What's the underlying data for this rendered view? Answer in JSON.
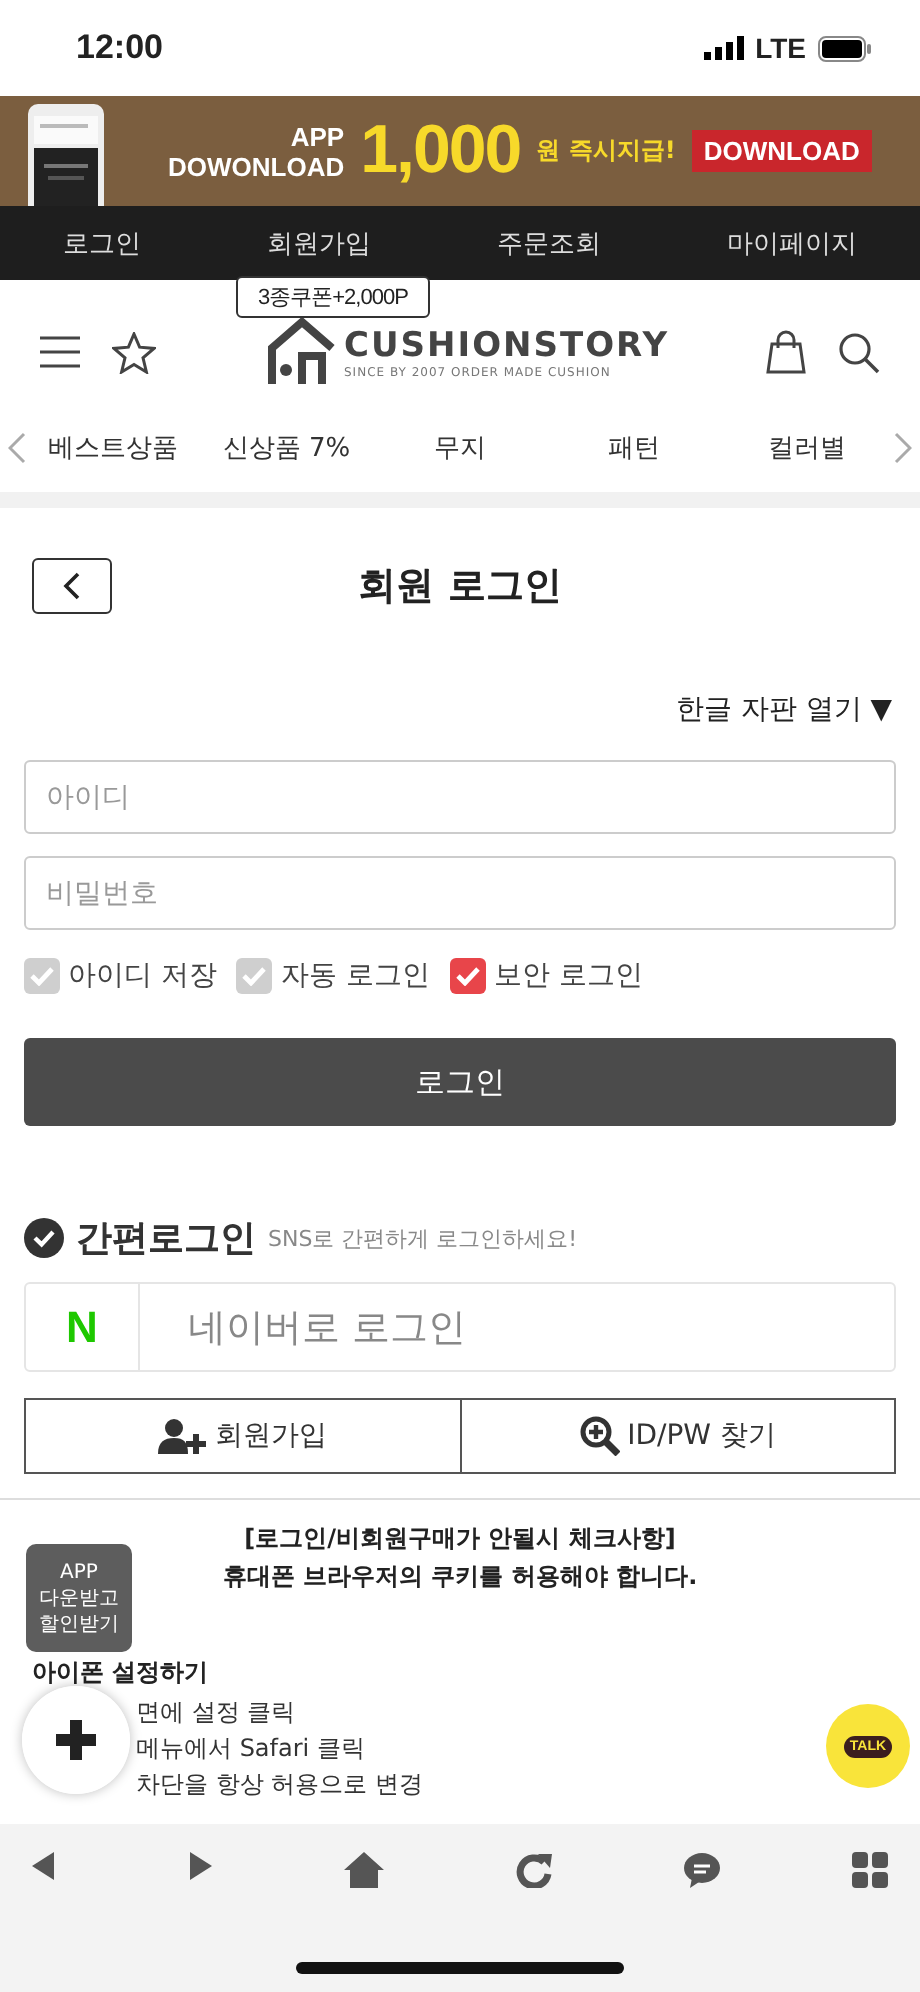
{
  "status_bar": {
    "time": "12:00",
    "network": "LTE"
  },
  "banner": {
    "app": "APP",
    "download_text": "DOWONLOAD",
    "amount": "1,000",
    "amount_suffix": "원 즉시지급!",
    "button": "DOWNLOAD"
  },
  "top_nav": [
    {
      "label": "로그인"
    },
    {
      "label": "회원가입"
    },
    {
      "label": "주문조회"
    },
    {
      "label": "마이페이지"
    }
  ],
  "coupon_tag": "3종쿠폰+2,000P",
  "logo": {
    "name": "CUSHIONSTORY",
    "tagline": "SINCE BY 2007 ORDER MADE CUSHION"
  },
  "categories": [
    {
      "label": "베스트상품"
    },
    {
      "label": "신상품 7%"
    },
    {
      "label": "무지"
    },
    {
      "label": "패턴"
    },
    {
      "label": "컬러별"
    }
  ],
  "page_title": "회원 로그인",
  "keyboard_toggle": "한글 자판 열기 ▼",
  "fields": [
    {
      "placeholder": "아이디"
    },
    {
      "placeholder": "비밀번호"
    }
  ],
  "options": [
    {
      "label": "아이디 저장",
      "checked": false
    },
    {
      "label": "자동 로그인",
      "checked": false
    },
    {
      "label": "보안 로그인",
      "checked": true
    }
  ],
  "login_button": "로그인",
  "sns": {
    "title": "간편로그인",
    "subtitle": "SNS로 간편하게 로그인하세요!",
    "naver_mark": "N",
    "naver_label": "네이버로 로그인"
  },
  "links": [
    {
      "kind": "join",
      "label": "회원가입"
    },
    {
      "kind": "find",
      "label": "ID/PW 찾기"
    }
  ],
  "notice": {
    "heading": "[로그인/비회원구매가 안될시 체크사항]",
    "line": "휴대폰 브라우저의 쿠키를 허용해야 합니다.",
    "subheading": "아이폰 설정하기",
    "steps": [
      "면에 설정 클릭",
      "메뉴에서 Safari 클릭",
      "차단을 항상 허용으로 변경"
    ]
  },
  "app_badge": [
    "APP",
    "다운받고",
    "할인받기"
  ],
  "talk_button": "TALK",
  "toolbar": [
    {
      "kind": "back"
    },
    {
      "kind": "forward"
    },
    {
      "kind": "home"
    },
    {
      "kind": "reload"
    },
    {
      "kind": "chat"
    },
    {
      "kind": "grid"
    }
  ]
}
